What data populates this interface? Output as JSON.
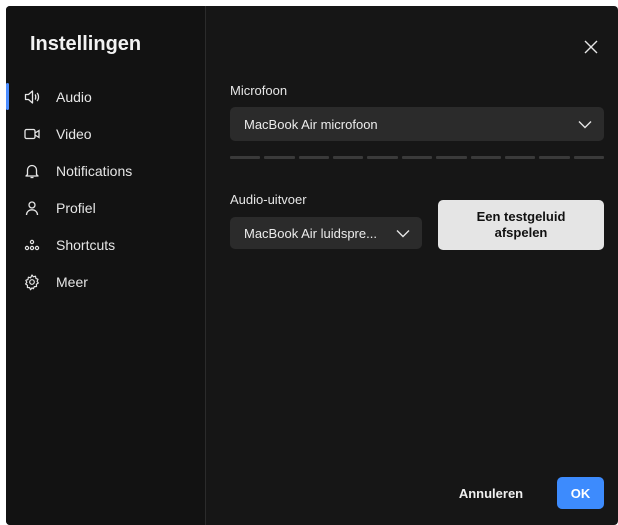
{
  "sidebar": {
    "title": "Instellingen",
    "items": [
      {
        "label": "Audio",
        "icon": "speaker-icon",
        "active": true
      },
      {
        "label": "Video",
        "icon": "video-camera-icon"
      },
      {
        "label": "Notifications",
        "icon": "bell-icon"
      },
      {
        "label": "Profiel",
        "icon": "person-icon"
      },
      {
        "label": "Shortcuts",
        "icon": "shortcuts-icon"
      },
      {
        "label": "Meer",
        "icon": "gear-icon"
      }
    ]
  },
  "audio": {
    "microphone_label": "Microfoon",
    "microphone_value": "MacBook Air microfoon",
    "output_label": "Audio-uitvoer",
    "output_value": "MacBook Air luidspre...",
    "test_button_line1": "Een testgeluid",
    "test_button_line2": "afspelen"
  },
  "footer": {
    "cancel_label": "Annuleren",
    "ok_label": "OK"
  },
  "colors": {
    "background": "#161616",
    "sidebar": "#121212",
    "accent": "#3d8bfd",
    "select": "#2b2b2b"
  }
}
